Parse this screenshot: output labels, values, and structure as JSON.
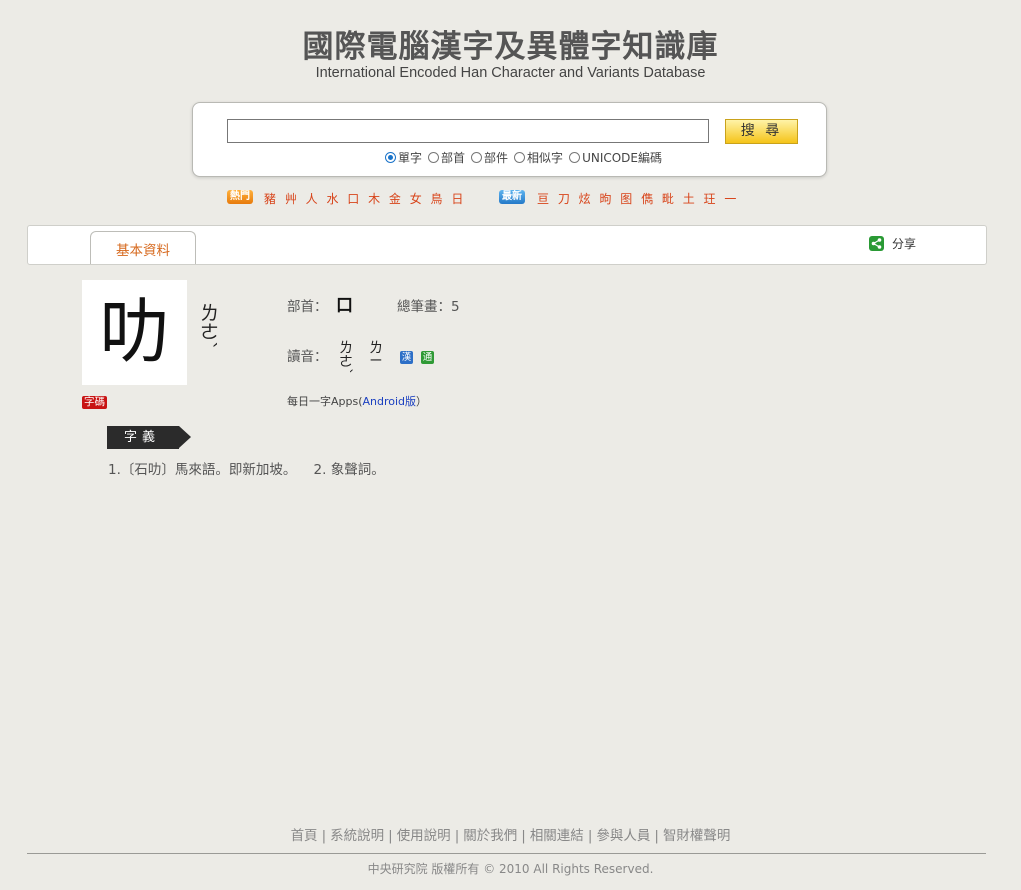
{
  "header": {
    "title_zh": "國際電腦漢字及異體字知識庫",
    "title_en": "International Encoded Han Character and Variants Database"
  },
  "search": {
    "input_value": "",
    "button_label": "搜 尋",
    "options": [
      {
        "label": "單字",
        "selected": true
      },
      {
        "label": "部首",
        "selected": false
      },
      {
        "label": "部件",
        "selected": false
      },
      {
        "label": "相似字",
        "selected": false
      },
      {
        "label": "UNICODE編碼",
        "selected": false
      }
    ]
  },
  "hot": {
    "tag": "熱門",
    "chars": "豬 艸 人 水 口 木 金 女 鳥 日"
  },
  "latest": {
    "tag": "最新",
    "chars": "亘 刀 炫 昫 图 儁 毗 土 玨 一"
  },
  "tabs": {
    "basic": "基本資料",
    "share": "分享"
  },
  "character": {
    "glyph": "叻",
    "zhuyin": "ㄌㄜˋ",
    "code_badge": "字碼",
    "radical_label": "部首：",
    "radical": "口",
    "strokes_label": "總筆畫：",
    "strokes": "5",
    "reading_label": "讀音：",
    "reading1": "ㄌㄜˋ",
    "reading2": "ㄌㄧ",
    "source_han": "漢",
    "source_tong": "通",
    "apps_prefix": "每日一字Apps(",
    "apps_link": "Android版",
    "apps_suffix": "）"
  },
  "meaning": {
    "label": "字義",
    "text": "1.〔石叻〕馬來語。即新加坡。    2. 象聲詞。"
  },
  "footer": {
    "links": [
      "首頁",
      "系統說明",
      "使用說明",
      "關於我們",
      "相關連結",
      "參與人員",
      "智財權聲明"
    ],
    "copyright": "中央研究院 版權所有 © 2010 All Rights Reserved."
  },
  "colors": {
    "accent_orange": "#d6691e",
    "hot_red": "#d8441a",
    "badge_red": "#c81414",
    "share_green": "#2a9a35"
  }
}
